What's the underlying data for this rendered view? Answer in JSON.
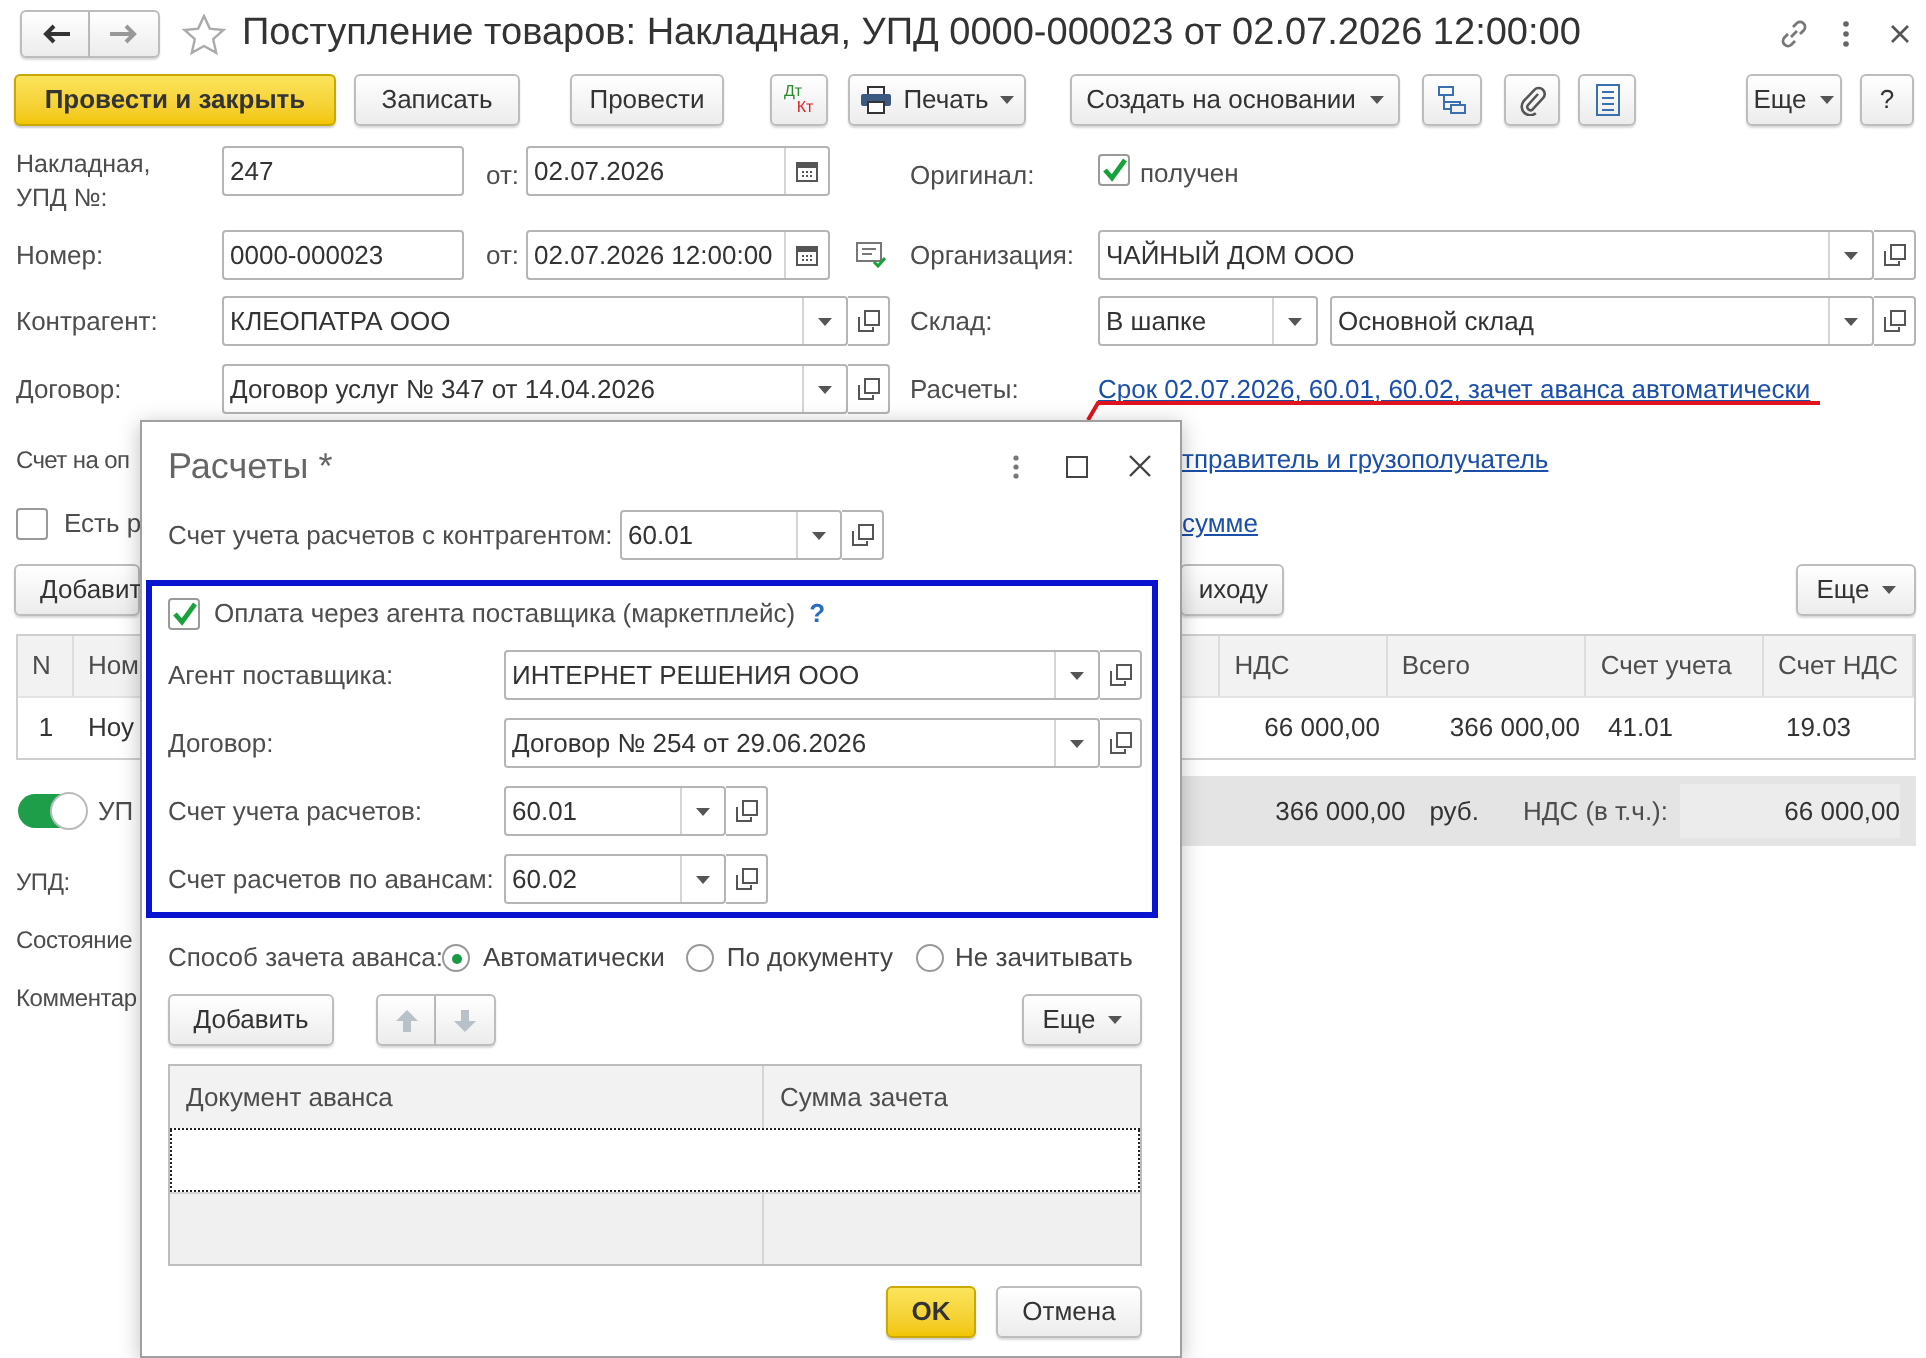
{
  "window": {
    "title": "Поступление товаров: Накладная, УПД 0000-000023 от 02.07.2026 12:00:00"
  },
  "toolbar": [
    {
      "kind": "primary",
      "label": "Провести и закрыть"
    },
    {
      "kind": "plain",
      "label": "Записать"
    },
    {
      "kind": "plain",
      "label": "Провести"
    },
    {
      "kind": "dtkt",
      "top": "Дт",
      "bottom": "Кт"
    },
    {
      "kind": "print",
      "label": "Печать"
    },
    {
      "kind": "menu",
      "label": "Создать на основании"
    },
    {
      "kind": "icon"
    },
    {
      "kind": "icon"
    },
    {
      "kind": "icon"
    },
    {
      "kind": "menu",
      "label": "Еще"
    },
    {
      "kind": "plain",
      "label": "?"
    }
  ],
  "header": {
    "invoice_label": "Накладная, УПД №:",
    "invoice_number": "247",
    "invoice_from_label": "от:",
    "invoice_date": "02.07.2026",
    "original_label": "Оригинал:",
    "original": {
      "label": "получен",
      "checked": true
    },
    "number_label": "Номер:",
    "number": "0000-000023",
    "date_from_label": "от:",
    "date": "02.07.2026 12:00:00",
    "organization_label": "Организация:",
    "organization": "ЧАЙНЫЙ ДОМ ООО",
    "counterparty_label": "Контрагент:",
    "counterparty": "КЛЕОПАТРА ООО",
    "warehouse_label": "Склад:",
    "warehouse_mode": "В шапке",
    "warehouse": "Основной склад",
    "contract_label": "Договор:",
    "contract": "Договор услуг № 347 от 14.04.2026",
    "settlements_label": "Расчеты:",
    "settlements_link": "Срок 02.07.2026, 60.01, 60.02, зачет аванса автоматически"
  },
  "partly_hidden": {
    "invoice_label": "Счет на оп",
    "shipper_link": "тправитель и грузополучатель",
    "checkbox": {
      "label": "Есть р",
      "checked": false
    },
    "sum_link": "сумме",
    "add_button": "Добавит",
    "fill_button": "иходу",
    "more_button": "Еще"
  },
  "goods_table": {
    "columns": [
      "N",
      "Ном",
      "НДС",
      "Всего",
      "Счет учета",
      "Счет НДС"
    ],
    "rows": [
      [
        "1",
        "Ноу",
        "66 000,00",
        "366 000,00",
        "41.01",
        "19.03"
      ]
    ]
  },
  "upd_toggle": {
    "label": "УП",
    "on": true
  },
  "totals": {
    "total": "366 000,00",
    "currency": "руб.",
    "vat_label": "НДС (в т.ч.):",
    "vat": "66 000,00"
  },
  "footer_labels": [
    "УПД:",
    "Состояние",
    "Комментар"
  ],
  "dialog": {
    "title": "Расчеты *",
    "account_label": "Счет учета расчетов с контрагентом:",
    "account": "60.01",
    "agent": {
      "checkbox": {
        "label": "Оплата через агента поставщика (маркетплейс)",
        "checked": true
      },
      "help": "?",
      "fields": [
        {
          "kind": "wide",
          "label": "Агент поставщика:",
          "value": "ИНТЕРНЕТ РЕШЕНИЯ ООО"
        },
        {
          "kind": "wide",
          "label": "Договор:",
          "value": "Договор № 254 от 29.06.2026"
        },
        {
          "kind": "short",
          "label": "Счет учета расчетов:",
          "value": "60.01"
        },
        {
          "kind": "short",
          "label": "Счет расчетов по авансам:",
          "value": "60.02"
        }
      ]
    },
    "advance": {
      "label": "Способ зачета аванса:",
      "options": [
        {
          "label": "Автоматически",
          "selected": true
        },
        {
          "label": "По документу",
          "selected": false
        },
        {
          "label": "Не зачитывать",
          "selected": false
        }
      ]
    },
    "add_button": "Добавить",
    "more_button": "Еще",
    "table": {
      "columns": [
        "Документ аванса",
        "Сумма зачета"
      ]
    },
    "ok_button": "OK",
    "cancel_button": "Отмена"
  }
}
